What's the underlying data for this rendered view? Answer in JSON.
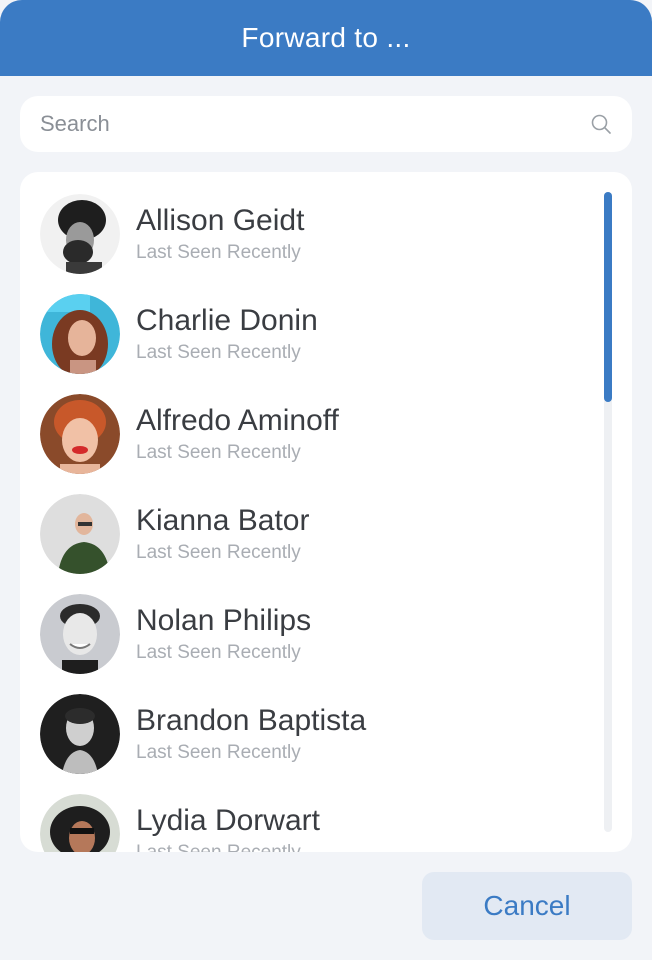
{
  "header": {
    "title": "Forward to ..."
  },
  "search": {
    "placeholder": "Search",
    "value": ""
  },
  "contacts": [
    {
      "name": "Allison Geidt",
      "status": "Last Seen Recently"
    },
    {
      "name": "Charlie Donin",
      "status": "Last Seen Recently"
    },
    {
      "name": "Alfredo Aminoff",
      "status": "Last Seen Recently"
    },
    {
      "name": "Kianna Bator",
      "status": "Last Seen Recently"
    },
    {
      "name": "Nolan Philips",
      "status": "Last Seen Recently"
    },
    {
      "name": "Brandon Baptista",
      "status": "Last Seen Recently"
    },
    {
      "name": "Lydia Dorwart",
      "status": "Last Seen Recently"
    }
  ],
  "footer": {
    "cancel_label": "Cancel"
  },
  "colors": {
    "accent": "#3b7bc4",
    "background": "#f2f4f8",
    "cancel_bg": "#e2e9f3"
  },
  "scrollbar": {
    "position": 0,
    "visible_fraction": 0.33
  }
}
